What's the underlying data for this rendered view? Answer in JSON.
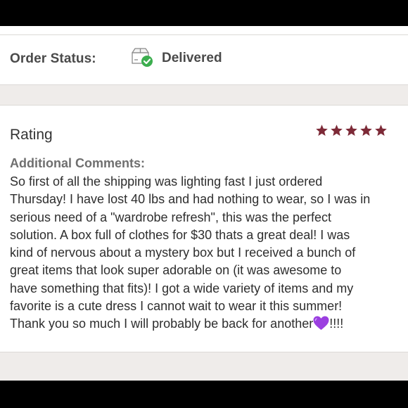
{
  "order": {
    "status_label": "Order Status:",
    "status_value": "Delivered",
    "status_icon": "delivered-box-icon",
    "status_icon_color": "#3cae4f"
  },
  "review": {
    "rating_label": "Rating",
    "rating_stars": 5,
    "rating_max": 5,
    "star_color": "#7d2a37",
    "comments_label": "Additional Comments:",
    "comment_lines": [
      "So first of all the shipping was lighting fast I just ordered",
      "Thursday! I have lost 40 lbs and had nothing to wear, so I was in",
      "serious need of a \"wardrobe refresh\", this was the perfect",
      "solution. A box full of clothes for $30 thats a great deal! I was",
      "kind of nervous about a mystery box but I received a bunch of",
      "great items that look super adorable on (it was awesome to",
      "have something that fits)! I got a wide variety of items and my",
      "favorite is a cute dress I cannot wait to wear it this summer!",
      "Thank you so much I will probably be back for another"
    ],
    "comment_tail": "!!!!",
    "heart_icon": "purple-heart-icon",
    "heart_color": "#9b3fe0"
  }
}
